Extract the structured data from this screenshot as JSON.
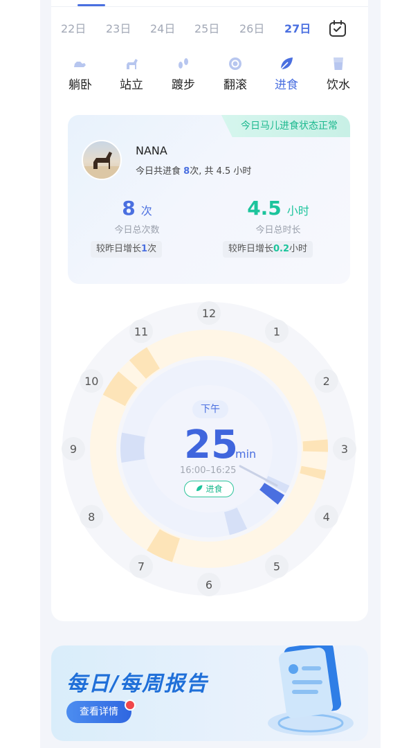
{
  "dates": {
    "items": [
      "22日",
      "23日",
      "24日",
      "25日",
      "26日",
      "27日"
    ],
    "active_index": 5
  },
  "tabs": {
    "items": [
      {
        "label": "躺卧",
        "icon": "lying-horse-icon"
      },
      {
        "label": "站立",
        "icon": "standing-horse-icon"
      },
      {
        "label": "踱步",
        "icon": "footsteps-icon"
      },
      {
        "label": "翻滚",
        "icon": "roll-icon"
      },
      {
        "label": "进食",
        "icon": "leaf-icon"
      },
      {
        "label": "饮水",
        "icon": "water-cup-icon"
      }
    ],
    "active_index": 4
  },
  "info": {
    "status_text": "今日马儿进食状态正常",
    "horse_name": "NANA",
    "summary_prefix": "今日共进食 ",
    "summary_count": "8",
    "summary_suffix": "次, 共 4.5 小时",
    "count_value": "8",
    "count_unit": "次",
    "count_caption": "今日总次数",
    "count_delta_prefix": "较昨日增长",
    "count_delta_value": "1",
    "count_delta_suffix": "次",
    "time_value": "4.5",
    "time_unit": "小时",
    "time_caption": "今日总时长",
    "time_delta_prefix": "较昨日增长",
    "time_delta_value": "0.2",
    "time_delta_suffix": "小时"
  },
  "clock": {
    "hours": [
      "12",
      "1",
      "2",
      "3",
      "4",
      "5",
      "6",
      "7",
      "8",
      "9",
      "10",
      "11"
    ],
    "period": "下午",
    "duration_value": "25",
    "duration_unit": "min",
    "time_range": "16:00–16:25",
    "activity_label": "进食"
  },
  "banner": {
    "title": "每日/每周报告",
    "button_label": "查看详情"
  },
  "colors": {
    "accent": "#4a6fe0",
    "green": "#1cc49c",
    "orange_segment": "#fde4b8",
    "blue_segment": "#d6e0f7"
  }
}
